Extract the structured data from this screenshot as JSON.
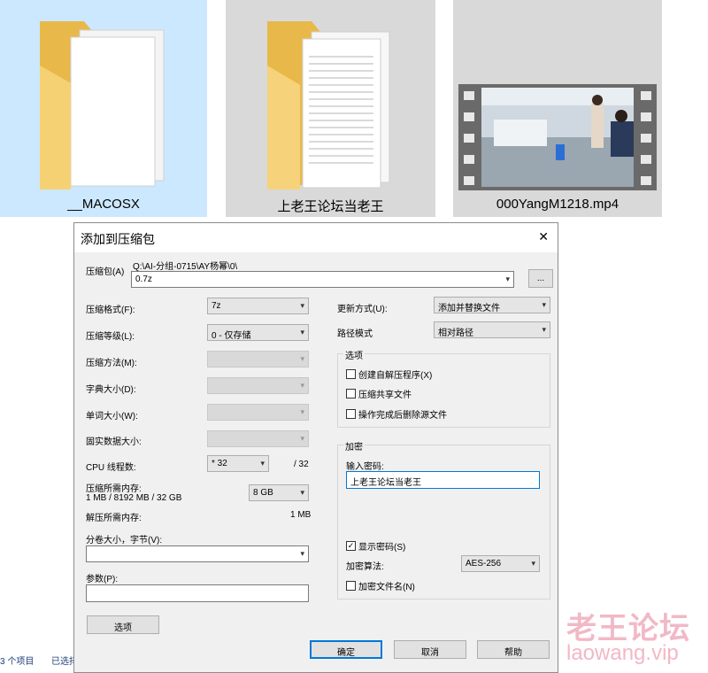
{
  "explorer": {
    "files": [
      {
        "name": "__MACOSX",
        "type": "folder",
        "selected": true,
        "icon": "folder-icon"
      },
      {
        "name": "上老王论坛当老王",
        "type": "folder",
        "selected": false,
        "icon": "folder-icon"
      },
      {
        "name": "000YangM1218.mp4",
        "type": "video",
        "selected": false,
        "icon": "video-thumbnail"
      }
    ],
    "status": {
      "count": "3 个项目",
      "selected": "已选择"
    }
  },
  "dialog": {
    "title": "添加到压缩包",
    "close": "✕",
    "archive_label": "压缩包(A)",
    "archive_path": "Q:\\AI-分组-0715\\AY杨幂\\0\\",
    "archive_name": "0.7z",
    "browse": "...",
    "left": {
      "format_label": "压缩格式(F):",
      "format_value": "7z",
      "level_label": "压缩等级(L):",
      "level_value": "0 - 仅存储",
      "method_label": "压缩方法(M):",
      "dict_label": "字典大小(D):",
      "word_label": "单词大小(W):",
      "solid_label": "固实数据大小:",
      "cpu_label": "CPU 线程数:",
      "cpu_value": "* 32",
      "cpu_max": "/ 32",
      "mem_comp_label": "压缩所需内存:",
      "mem_comp_detail": "1 MB / 8192 MB / 32 GB",
      "mem_value": "8 GB",
      "mem_decomp_label": "解压所需内存:",
      "mem_decomp_value": "1 MB",
      "split_label": "分卷大小，字节(V):",
      "split_value": "",
      "params_label": "参数(P):",
      "params_value": "",
      "options_button": "选项"
    },
    "right": {
      "update_label": "更新方式(U):",
      "update_value": "添加并替换文件",
      "path_label": "路径模式",
      "path_value": "相对路径",
      "options_group": "选项",
      "opt_sfx": "创建自解压程序(X)",
      "opt_shared": "压缩共享文件",
      "opt_delete": "操作完成后删除源文件",
      "encrypt_group": "加密",
      "password_label": "输入密码:",
      "password_value": "上老王论坛当老王",
      "show_password": "显示密码(S)",
      "method_label": "加密算法:",
      "method_value": "AES-256",
      "encrypt_names": "加密文件名(N)"
    },
    "buttons": {
      "ok": "确定",
      "cancel": "取消",
      "help": "帮助"
    }
  },
  "watermark": {
    "cn": "老王论坛",
    "url": "laowang.vip"
  }
}
